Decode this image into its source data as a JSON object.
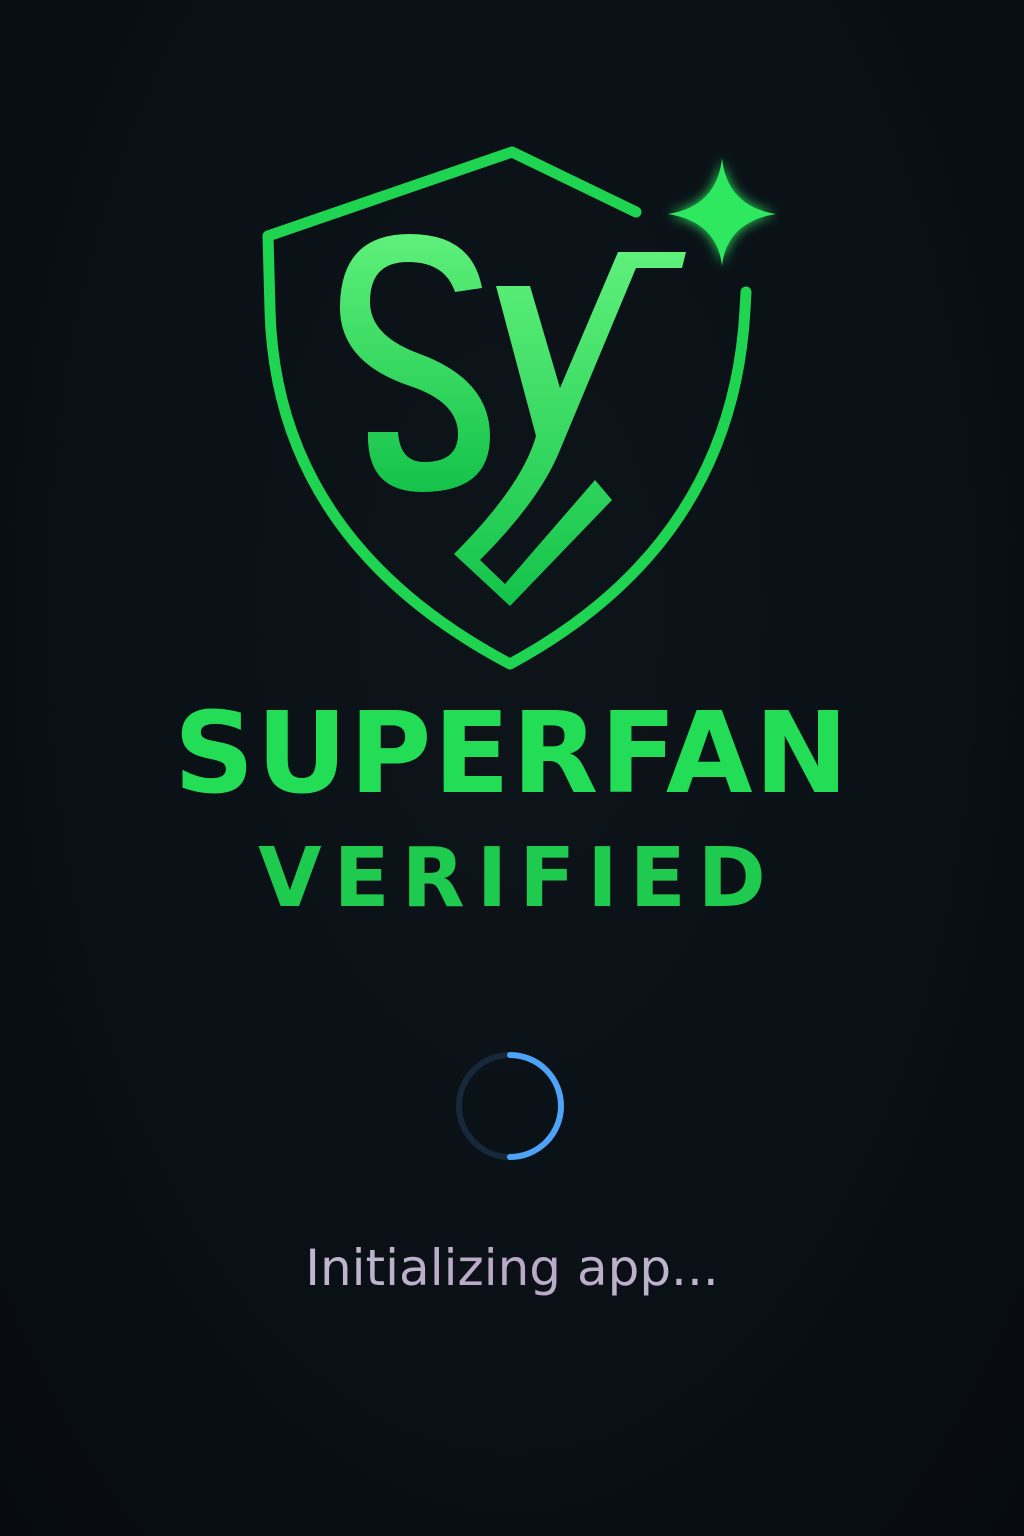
{
  "app": {
    "logo_name": "shield-sy-logo",
    "title_line1": "SUPERFAN",
    "title_line2": "VERIFIED"
  },
  "loader": {
    "icon": "loading-spinner-icon",
    "status_text": "Initializing app..."
  },
  "colors": {
    "background": "#0a0f14",
    "brand_green": "#22dd55",
    "spinner_blue": "#4da3f5",
    "status_text": "#c9cfd6"
  }
}
